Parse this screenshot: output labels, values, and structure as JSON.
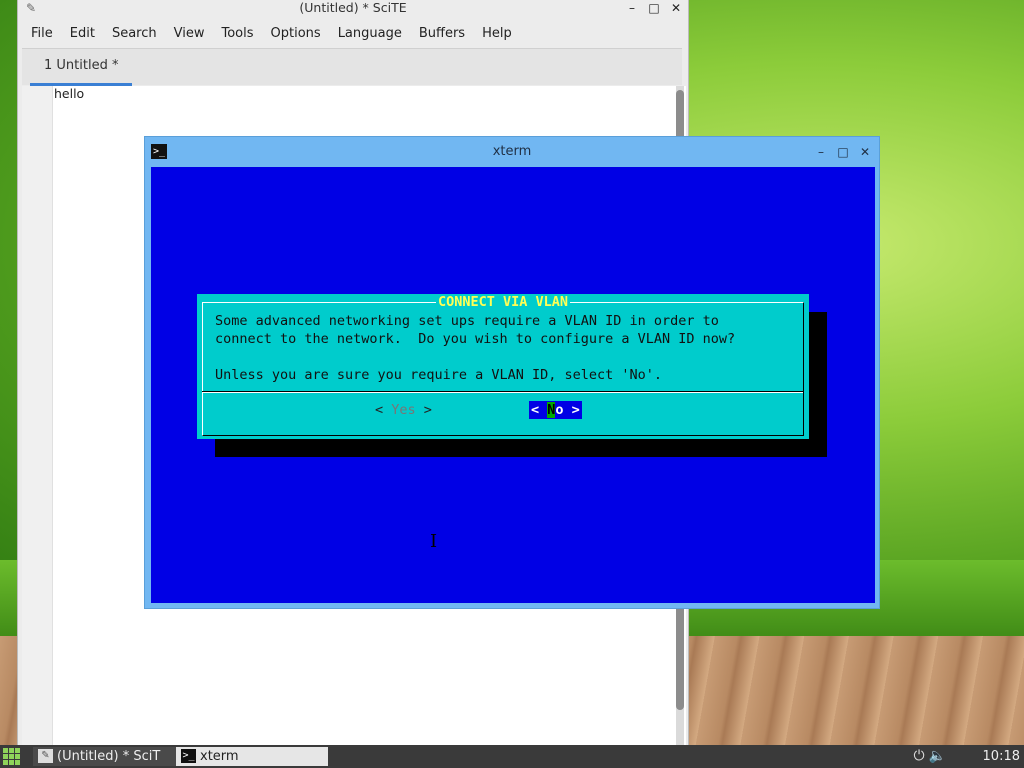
{
  "scite": {
    "title": "(Untitled) * SciTE",
    "menu": [
      "File",
      "Edit",
      "Search",
      "View",
      "Tools",
      "Options",
      "Language",
      "Buffers",
      "Help"
    ],
    "tab_label": "1 Untitled *",
    "editor_text": "hello"
  },
  "window_controls": {
    "minimize": "–",
    "maximize": "□",
    "close": "✕"
  },
  "xterm": {
    "title": "xterm",
    "dialog": {
      "title": "CONNECT VIA VLAN",
      "line1": "Some advanced networking set ups require a VLAN ID in order to",
      "line2": "connect to the network.  Do you wish to configure a VLAN ID now?",
      "line3": "Unless you are sure you require a VLAN ID, select 'No'.",
      "yes_button": {
        "pre": "< ",
        "hot": "Y",
        "rest": "es",
        "post": " >"
      },
      "no_button": {
        "pre": "< ",
        "hot": "N",
        "rest": "o",
        "post": " >"
      }
    }
  },
  "taskbar": {
    "tasks": [
      "(Untitled) * SciT",
      "xterm"
    ],
    "clock": "10:18",
    "tray_icons": [
      "power-icon",
      "volume-icon"
    ]
  },
  "colors": {
    "terminal_bg": "#0000e5",
    "dialog_bg": "#00cccc",
    "dialog_title": "#ffff55",
    "xterm_frame": "#71b7f2",
    "tab_accent": "#3a7fd4"
  }
}
